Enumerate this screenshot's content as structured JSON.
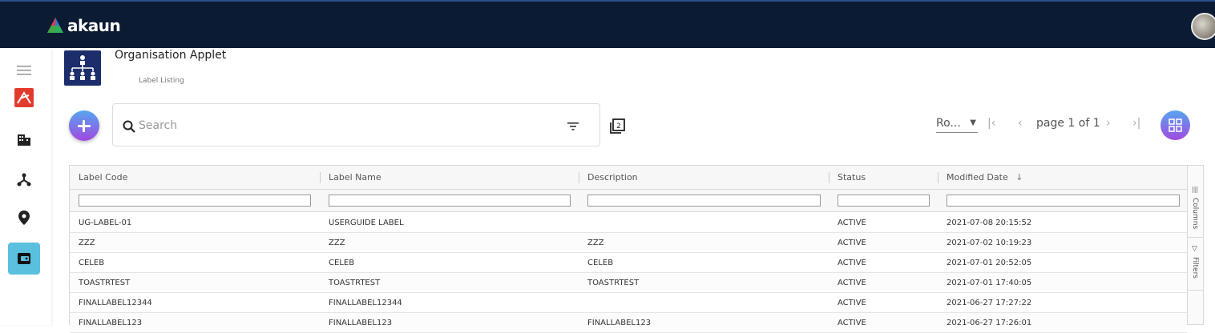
{
  "app": {
    "brand": "akaun",
    "applet_title": "Organisation Applet",
    "applet_subtitle": "Label Listing"
  },
  "toolbar": {
    "search_placeholder": "Search",
    "rows_label": "Ro...",
    "page_label": "page 1 of 1"
  },
  "table": {
    "columns": [
      "Label Code",
      "Label Name",
      "Description",
      "Status",
      "Modified Date"
    ],
    "sort_indicator": "↓",
    "rows": [
      {
        "code": "UG-LABEL-01",
        "name": "USERGUIDE LABEL",
        "description": "",
        "status": "ACTIVE",
        "modified": "2021-07-08 20:15:52"
      },
      {
        "code": "ZZZ",
        "name": "ZZZ",
        "description": "ZZZ",
        "status": "ACTIVE",
        "modified": "2021-07-02 10:19:23"
      },
      {
        "code": "CELEB",
        "name": "CELEB",
        "description": "CELEB",
        "status": "ACTIVE",
        "modified": "2021-07-01 20:52:05"
      },
      {
        "code": "TOASTRTEST",
        "name": "TOASTRTEST",
        "description": "TOASTRTEST",
        "status": "ACTIVE",
        "modified": "2021-07-01 17:40:05"
      },
      {
        "code": "FINALLABEL12344",
        "name": "FINALLABEL12344",
        "description": "",
        "status": "ACTIVE",
        "modified": "2021-06-27 17:27:22"
      },
      {
        "code": "FINALLABEL123",
        "name": "FINALLABEL123",
        "description": "FINALLABEL123",
        "status": "ACTIVE",
        "modified": "2021-06-27 17:26:01"
      }
    ]
  },
  "side_panel": {
    "columns_label": "Columns",
    "filters_label": "Filters"
  },
  "icons": {
    "menu": "hamburger-menu-icon",
    "app1": "acrobat-like-icon",
    "company": "building-icon",
    "org": "network-icon",
    "location": "location-pin-icon",
    "label": "label-tag-icon"
  },
  "colors": {
    "topbar": "#0b1b33",
    "accent_gradient_start": "#56a6f0",
    "accent_gradient_end": "#a148e0",
    "active_rail": "#5bc0de"
  }
}
